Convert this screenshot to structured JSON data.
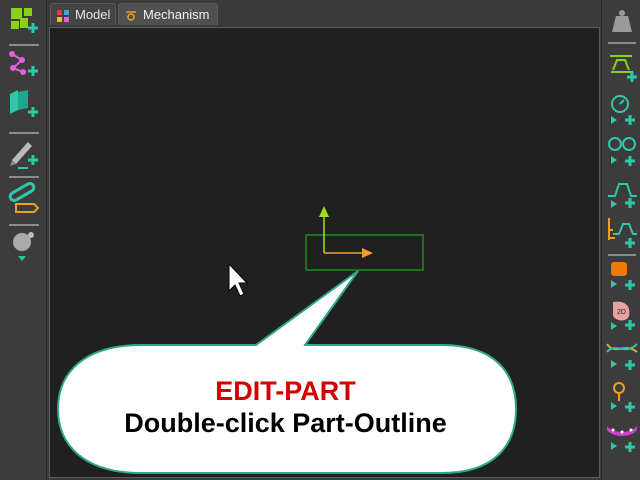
{
  "tabs": [
    {
      "label": "Model",
      "icon": "model-icon"
    },
    {
      "label": "Mechanism",
      "icon": "mechanism-icon",
      "active": true
    }
  ],
  "left_toolbar": {
    "tools": [
      "add-part-icon",
      "add-kinematic-chain-icon",
      "add-linkage-icon",
      "add-pen-edit-icon",
      "add-link-icon",
      "add-sphere-icon"
    ]
  },
  "right_toolbar": {
    "tools": [
      "weight-icon",
      "motion-dimension-icon",
      "rotary-motion-icon",
      "belt-drive-icon",
      "cam-profile-icon",
      "cam-motion-icon",
      "add-block-icon",
      "add-2d-part-icon",
      "add-curve-icon",
      "add-pin-icon",
      "add-chain-icon"
    ]
  },
  "callout": {
    "title": "EDIT-PART",
    "subtitle": "Double-click Part-Outline"
  },
  "colors": {
    "accent_green": "#2ec8a8",
    "part_outline": "#1f8a1f",
    "axis_x": "#f0a020",
    "axis_y": "#a0e020",
    "callout_title": "#d40000"
  }
}
